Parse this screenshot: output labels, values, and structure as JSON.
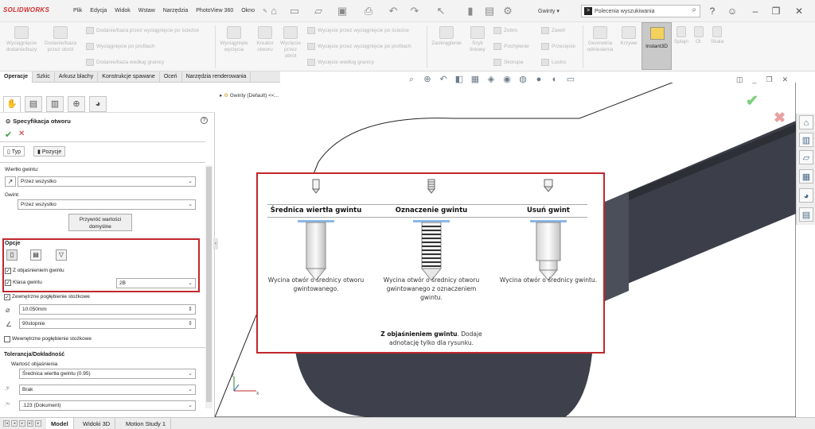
{
  "app": {
    "logo": "SOLIDWORKS",
    "menu": [
      "Plik",
      "Edycja",
      "Widok",
      "Wstaw",
      "Narzędzia",
      "PhotoView 360",
      "Okno"
    ],
    "config_dropdown": "Gwinty",
    "search_placeholder": "Polecenia wyszukiwania"
  },
  "ribbon": {
    "extrude_boss": "Wyciągnięcie\ndodania/bazy",
    "revolve_boss": "Dodanie/baza\nprzez obrót",
    "sweep_boss": "Dodanie/baza przez wyciągnięcie po ścieżce",
    "loft_boss": "Wyciągnięcie po profilach",
    "boundary_boss": "Dodanie/baza według granicy",
    "extrude_cut": "Wyciągnięte\nwycięcia",
    "hole_wizard": "Kreator\notworu",
    "revolve_cut": "Wycięcie\nprzez\nobrót",
    "sweep_cut": "Wycięcie przez wyciągnięcie po ścieżce",
    "loft_cut": "Wycięcie przez wyciągnięcie po profilach",
    "boundary_cut": "Wycięcie według granicy",
    "fillet": "Zaokrąglenie",
    "linear_pattern": "Szyk\nliniowy",
    "rib": "Żebro",
    "draft": "Pochylenie",
    "shell": "Skorupa",
    "wrap": "Zawiń",
    "intersect": "Przecięcie",
    "mirror": "Lustro",
    "ref_geometry": "Geometria\nodniesienia",
    "curves": "Krzywe",
    "instant3d": "Instant3D",
    "splines": "Splajn",
    "ol": "Ol.",
    "scale": "Skala"
  },
  "tabs": [
    "Operacje",
    "Szkic",
    "Arkusz blachy",
    "Konstrukcje spawane",
    "Oceń",
    "Narzędzia renderowania"
  ],
  "panel": {
    "title": "Specyfikacja otworu",
    "subtab_type": "Typ",
    "subtab_position": "Pozycje",
    "tap_drill_label": "Wiertło gwintu:",
    "tap_drill_value": "Przez wszystko",
    "thread_label": "Gwint:",
    "thread_value": "Przez wszystko",
    "restore_button": "Przywróć wartości\ndomyślne",
    "options_header": "Opcje",
    "with_callout": "Z objaśnieniem gwintu",
    "thread_class": "Klasa gwintu",
    "thread_class_value": "2B",
    "near_csink": "Zewnętrzne pogłębienie stożkowe",
    "csink_diameter": "10.050mm",
    "csink_angle": "90stopnie",
    "far_csink": "Wewnętrzne pogłębienie stożkowe",
    "tolerance_header": "Tolerancja/Dokładność",
    "callout_value_label": "Wartość objaśnienia",
    "callout_value": "Średnica wiertła gwintu (0.95)",
    "tolerance_value": "Brak",
    "precision_value": ".123 (Dokument)"
  },
  "tree": {
    "item": "Gwinty (Default) <<..."
  },
  "callout": {
    "col1_header": "Średnica wiertła gwintu",
    "col1_desc": "Wycina otwór o średnicy otworu gwintowanego.",
    "col2_header": "Oznaczenie gwintu",
    "col2_desc": "Wycina otwór o średnicy otworu gwintowanego z oznaczeniem gwintu.",
    "col2_note_bold": "Z objaśnieniem gwintu",
    "col2_note": ". Dodaje adnotację tylko dla rysunku.",
    "col3_header": "Usuń gwint",
    "col3_desc": "Wycina otwór o średnicy gwintu."
  },
  "bottom_tabs": [
    "Model",
    "Widoki 3D",
    "Motion Study 1"
  ],
  "colors": {
    "highlight": "#c1272d",
    "accent_red": "#d32f2f",
    "part_dark": "#3b3e48",
    "part_side": "#5a5e6a"
  },
  "icons": {
    "home": "home-icon",
    "search": "search-icon",
    "help": "help-icon",
    "user": "user-icon"
  }
}
